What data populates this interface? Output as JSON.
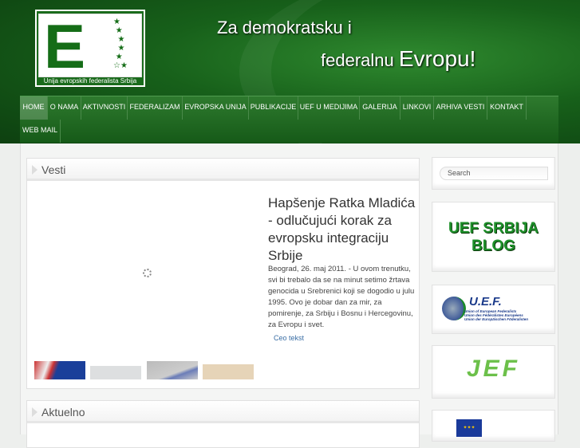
{
  "header": {
    "logo_caption": "Unija evropskih federalista Srbija",
    "logo_letter": "E",
    "slogan_line1": "Za demokratsku i",
    "slogan_line2": "federalnu",
    "slogan_emph": "Evropu!"
  },
  "nav": {
    "items": [
      "HOME",
      "O NAMA",
      "AKTIVNOSTI",
      "FEDERALIZAM",
      "EVROPSKA UNIJA",
      "PUBLIKACIJE",
      "UEF U MEDIJIMA",
      "GALERIJA",
      "LINKOVI",
      "ARHIVA VESTI",
      "KONTAKT",
      "WEB MAIL"
    ]
  },
  "vesti": {
    "title": "Vesti",
    "headline": "Hapšenje Ratka Mladića - odlučujući korak za evropsku integraciju Srbije",
    "excerpt": "Beograd, 26. maj 2011. - U ovom trenutku, svi bi trebalo da se na minut setimo žrtava genocida u Srebrenici koji se dogodio u julu 1995. Ovo je dobar dan za mir, za pomirenje, za Srbiju i Bosnu i Hercegovinu, za Evropu i svet.",
    "more": "Ceo tekst"
  },
  "aktuelno": {
    "title": "Aktuelno"
  },
  "sidebar": {
    "search_placeholder": "Search",
    "banners": {
      "blog_line1": "UEF SRBIJA",
      "blog_line2": "BLOG",
      "uef_title": "U.E.F.",
      "uef_sub1": "Union of European Federalists",
      "uef_sub2": "Union des Fédéralistes Européens",
      "uef_sub3": "Union der Europäischen Föderalisten",
      "jef": "JEF"
    }
  }
}
